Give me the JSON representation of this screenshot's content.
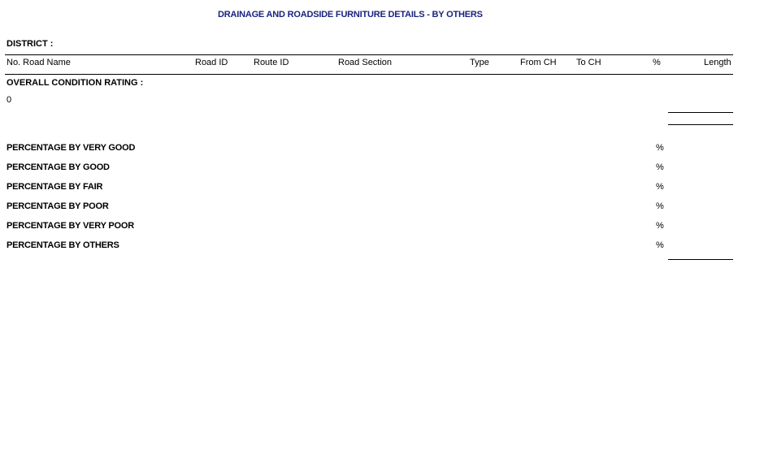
{
  "report": {
    "title": "DRAINAGE AND ROADSIDE FURNITURE DETAILS - BY OTHERS",
    "district_label": "DISTRICT :",
    "columns": {
      "no_road_name": "No.  Road Name",
      "road_id": "Road ID",
      "route_id": "Route ID",
      "road_section": "Road Section",
      "type": "Type",
      "from_ch": "From CH",
      "to_ch": "To CH",
      "percent": "%",
      "length": "Length"
    },
    "overall_label": "OVERALL CONDITION RATING :",
    "overall_value": "0",
    "percentages": [
      {
        "label": "PERCENTAGE BY VERY GOOD",
        "unit": "%"
      },
      {
        "label": "PERCENTAGE BY GOOD",
        "unit": "%"
      },
      {
        "label": "PERCENTAGE BY FAIR",
        "unit": "%"
      },
      {
        "label": "PERCENTAGE BY POOR",
        "unit": "%"
      },
      {
        "label": "PERCENTAGE BY VERY POOR",
        "unit": "%"
      },
      {
        "label": "PERCENTAGE BY OTHERS",
        "unit": "%"
      }
    ]
  },
  "colors": {
    "title": "#1a237e",
    "text": "#000000",
    "background": "#ffffff"
  }
}
